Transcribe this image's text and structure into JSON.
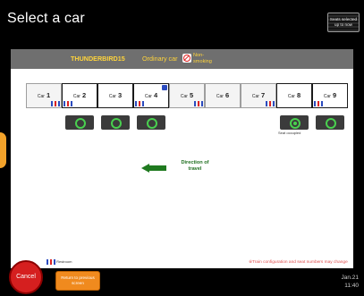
{
  "header": {
    "title": "Select a car",
    "seat_info_button": "Seats selected up to now"
  },
  "train": {
    "name": "THUNDERBIRD15",
    "car_type": "Ordinary car",
    "smoking": "Non-smoking"
  },
  "cars": [
    {
      "car_label": "Car",
      "number": "1",
      "selected": false,
      "toilet": true,
      "wheelchair": false,
      "button": false
    },
    {
      "car_label": "Car",
      "number": "2",
      "selected": true,
      "toilet": true,
      "wheelchair": false,
      "button": true
    },
    {
      "car_label": "Car",
      "number": "3",
      "selected": true,
      "toilet": false,
      "wheelchair": false,
      "button": true
    },
    {
      "car_label": "Car",
      "number": "4",
      "selected": true,
      "toilet": true,
      "wheelchair": true,
      "button": true
    },
    {
      "car_label": "Car",
      "number": "5",
      "selected": false,
      "toilet": true,
      "wheelchair": false,
      "button": false
    },
    {
      "car_label": "Car",
      "number": "6",
      "selected": false,
      "toilet": false,
      "wheelchair": false,
      "button": false
    },
    {
      "car_label": "Car",
      "number": "7",
      "selected": false,
      "toilet": true,
      "wheelchair": false,
      "button": false
    },
    {
      "car_label": "Car",
      "number": "8",
      "selected": true,
      "toilet": false,
      "wheelchair": false,
      "button": true,
      "note": "Seat occupied"
    },
    {
      "car_label": "Car",
      "number": "9",
      "selected": true,
      "toilet": true,
      "wheelchair": false,
      "button": true
    }
  ],
  "direction": {
    "label": "Direction of travel"
  },
  "legend": {
    "restroom_label": "Restroom"
  },
  "note": "※Train configuration and seat numbers may change",
  "footer": {
    "cancel": "Cancel",
    "return": "Return to previous screen",
    "date": "Jan.21",
    "time": "11:40"
  },
  "colors": {
    "accent_green": "#49d04f",
    "cancel_red": "#d51f1f",
    "return_orange": "#f08a1e",
    "train_bar_text": "#ffd43b"
  }
}
